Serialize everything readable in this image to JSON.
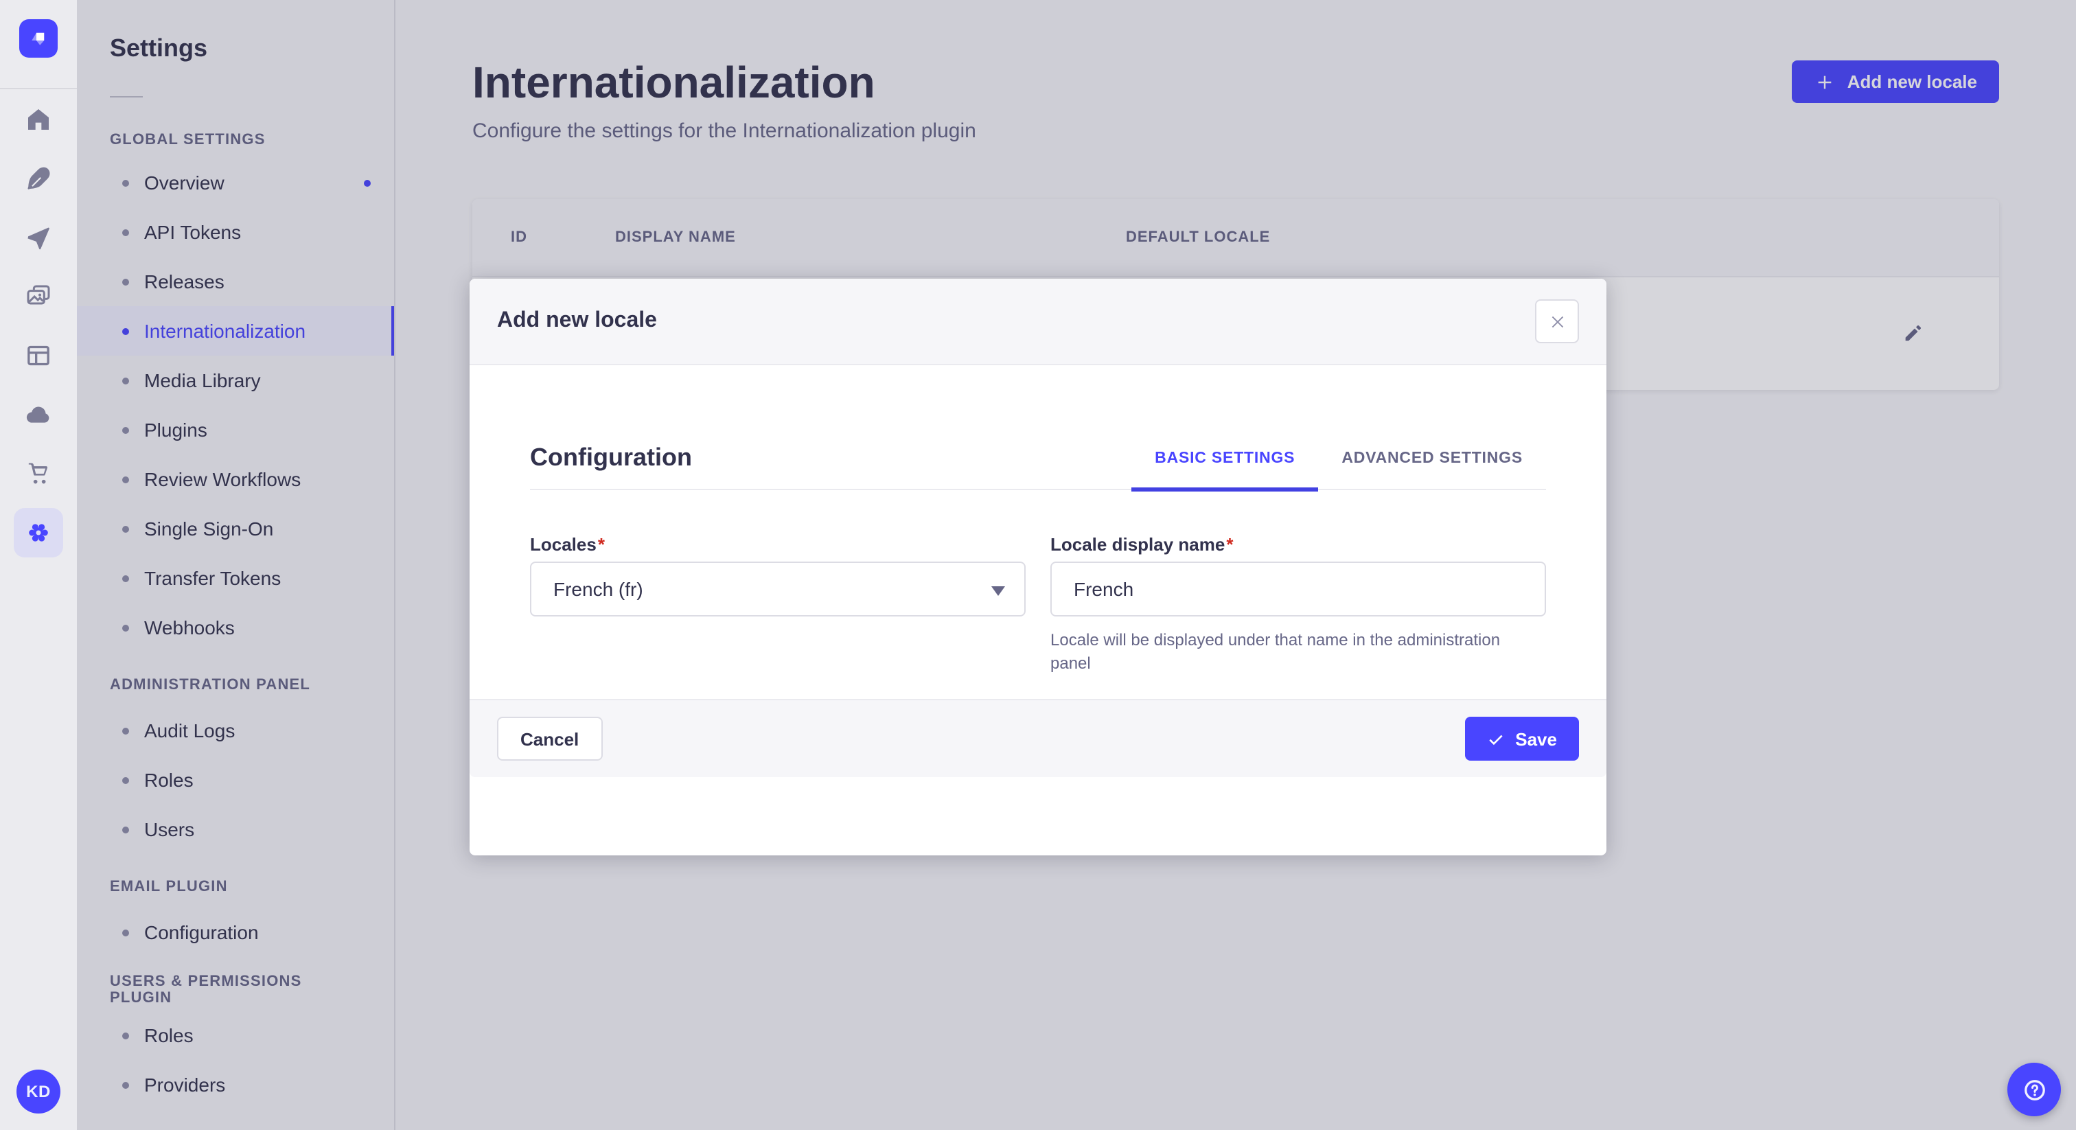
{
  "rail": {
    "icons": [
      "strapi-logo",
      "home",
      "content-feather",
      "release-plane",
      "media-library",
      "layout",
      "cloud",
      "marketplace-cart",
      "settings-gear"
    ],
    "active_icon": "settings-gear",
    "avatar_initials": "KD"
  },
  "sidebar": {
    "title": "Settings",
    "sections": [
      {
        "header": "GLOBAL SETTINGS",
        "items": [
          "Overview",
          "API Tokens",
          "Releases",
          "Internationalization",
          "Media Library",
          "Plugins",
          "Review Workflows",
          "Single Sign-On",
          "Transfer Tokens",
          "Webhooks"
        ],
        "active_item": "Internationalization",
        "notification_on": "Overview"
      },
      {
        "header": "ADMINISTRATION PANEL",
        "items": [
          "Audit Logs",
          "Roles",
          "Users"
        ]
      },
      {
        "header": "EMAIL PLUGIN",
        "items": [
          "Configuration"
        ]
      },
      {
        "header": "USERS & PERMISSIONS PLUGIN",
        "items": [
          "Roles",
          "Providers"
        ]
      }
    ]
  },
  "main": {
    "title": "Internationalization",
    "subtitle": "Configure the settings for the Internationalization plugin",
    "add_button_label": "Add new locale",
    "table": {
      "columns": [
        "ID",
        "DISPLAY NAME",
        "DEFAULT LOCALE"
      ],
      "row_action_icon": "edit-pencil"
    }
  },
  "modal": {
    "title": "Add new locale",
    "close_icon": "close-x",
    "section_title": "Configuration",
    "tabs": [
      {
        "label": "BASIC SETTINGS",
        "active": true
      },
      {
        "label": "ADVANCED SETTINGS",
        "active": false
      }
    ],
    "form": {
      "required_marker": "*",
      "locales": {
        "label": "Locales",
        "value": "French (fr)"
      },
      "display_name": {
        "label": "Locale display name",
        "value": "French",
        "helper": "Locale will be displayed under that name in the administration panel"
      }
    },
    "footer": {
      "cancel_label": "Cancel",
      "save_label": "Save",
      "save_icon": "check"
    }
  },
  "help_button": {
    "icon": "question-mark"
  },
  "colors": {
    "accent": "#4945ff",
    "text_dark": "#32324d",
    "text_muted": "#666687",
    "border": "#dcdce4",
    "divider": "#eaeaef",
    "surface": "#ffffff",
    "surface_alt": "#f6f6f9",
    "active_item_bg": "#f0f0ff",
    "required": "#d02b20",
    "overlay": "rgba(50,50,77,0.2)"
  }
}
